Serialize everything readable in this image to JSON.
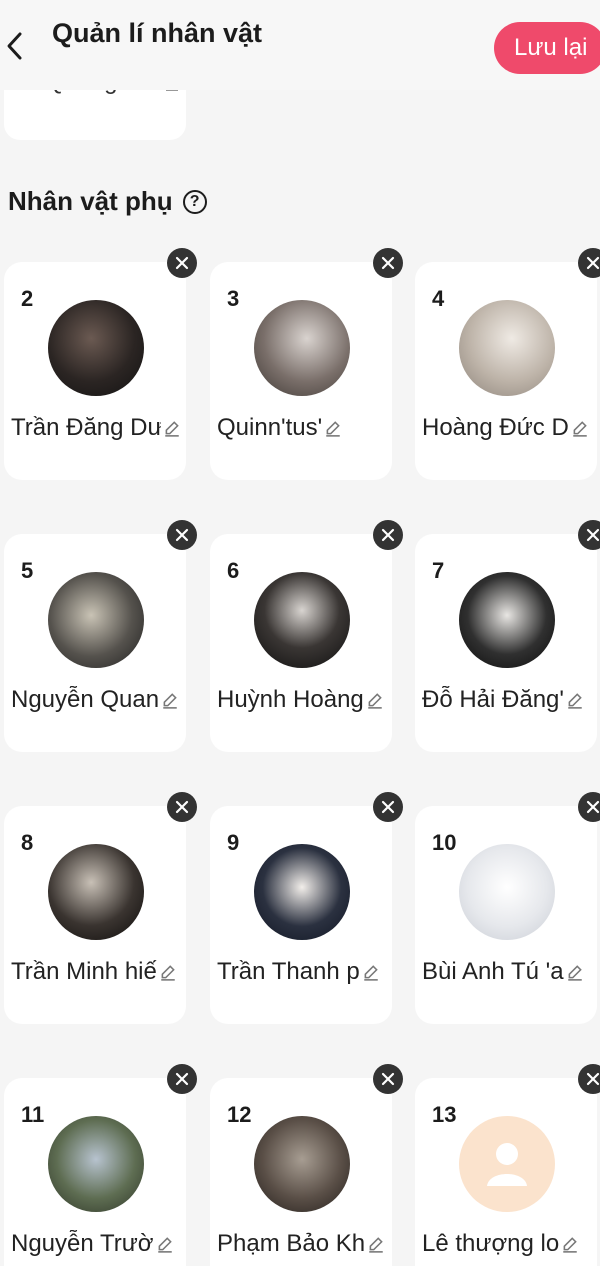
{
  "header": {
    "title": "Quản lí nhân vật",
    "save_label": "Lưu lại",
    "back_icon": "chevron-left-icon"
  },
  "main_character": {
    "name": "Lê Quang Hữ"
  },
  "section": {
    "title": "Nhân vật phụ",
    "help_icon": "question-circle-icon"
  },
  "colors": {
    "accent": "#ef4a6b",
    "background": "#f5f5f5",
    "card": "#ffffff",
    "placeholder_avatar": "#fbe3cd"
  },
  "characters": [
    {
      "number": "2",
      "name": "Trần Đăng Dư"
    },
    {
      "number": "3",
      "name": "Quinn'tus'"
    },
    {
      "number": "4",
      "name": "Hoàng Đức D"
    },
    {
      "number": "5",
      "name": "Nguyễn Quan"
    },
    {
      "number": "6",
      "name": "Huỳnh Hoàng"
    },
    {
      "number": "7",
      "name": "Đỗ Hải Đăng'"
    },
    {
      "number": "8",
      "name": "Trần Minh hiế"
    },
    {
      "number": "9",
      "name": "Trần Thanh p"
    },
    {
      "number": "10",
      "name": "Bùi Anh Tú 'a"
    },
    {
      "number": "11",
      "name": "Nguyễn Trườ"
    },
    {
      "number": "12",
      "name": "Phạm Bảo Kh"
    },
    {
      "number": "13",
      "name": "Lê thượng lo"
    }
  ]
}
